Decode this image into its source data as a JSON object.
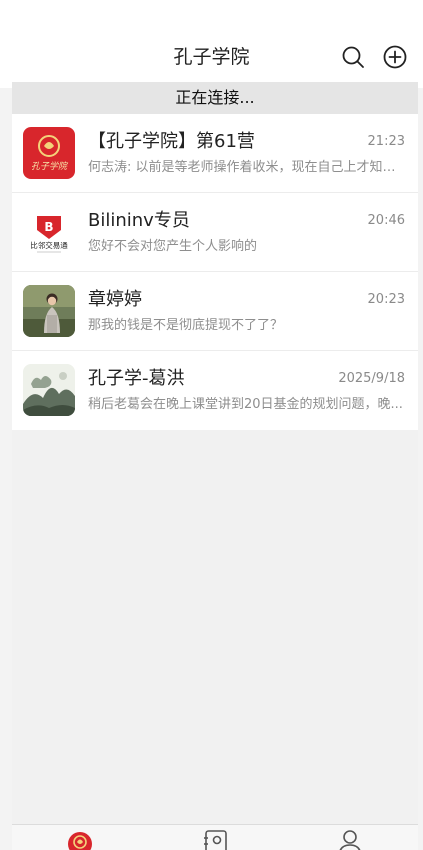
{
  "header": {
    "title": "孔子学院",
    "search_icon": "search-icon",
    "add_icon": "plus-circle-icon"
  },
  "status": {
    "text": "正在连接..."
  },
  "chats": [
    {
      "name": "【孔子学院】第61营",
      "time": "21:23",
      "preview": "何志涛: 以前是等老师操作着收米，现在自己上才知道...",
      "avatar_text": "孔子学院"
    },
    {
      "name": "Bilininv专员",
      "time": "20:46",
      "preview": "您好不会对您产生个人影响的",
      "avatar_text": "比邻交易通"
    },
    {
      "name": "章婷婷",
      "time": "20:23",
      "preview": "那我的钱是不是彻底提现不了了？"
    },
    {
      "name": "孔子学-葛洪",
      "time": "2025/9/18",
      "preview": "稍后老葛会在晚上课堂讲到20日基金的规划问题，晚..."
    }
  ],
  "tabs": [
    {
      "icon": "chats-logo-icon"
    },
    {
      "icon": "contacts-icon"
    },
    {
      "icon": "profile-icon"
    }
  ],
  "colors": {
    "accent_red": "#d8262c",
    "background": "#f3f3f3",
    "status_bg": "#e5e5e5"
  }
}
